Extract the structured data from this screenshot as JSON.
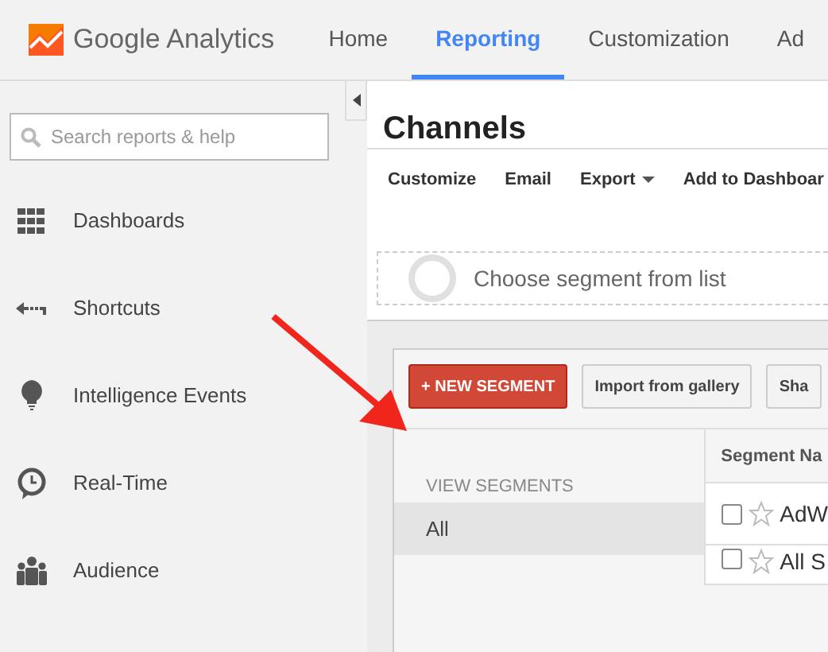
{
  "app": {
    "logo_text": "Google Analytics"
  },
  "nav_tabs": [
    {
      "label": "Home",
      "selected": false
    },
    {
      "label": "Reporting",
      "selected": true
    },
    {
      "label": "Customization",
      "selected": false
    },
    {
      "label": "Ad",
      "selected": false
    }
  ],
  "sidebar": {
    "search": {
      "placeholder": "Search reports & help"
    },
    "items": [
      {
        "label": "Dashboards",
        "kind": "grid"
      },
      {
        "label": "Shortcuts",
        "kind": "shortcut"
      },
      {
        "label": "Intelligence Events",
        "kind": "bulb"
      },
      {
        "label": "Real-Time",
        "kind": "clock"
      },
      {
        "label": "Audience",
        "kind": "people"
      }
    ]
  },
  "report": {
    "title": "Channels",
    "toolbar": [
      {
        "label": "Customize",
        "kind": "plain"
      },
      {
        "label": "Email",
        "kind": "plain"
      },
      {
        "label": "Export",
        "kind": "menu"
      },
      {
        "label": "Add to Dashboar",
        "kind": "plain"
      }
    ],
    "segment_picker": {
      "placeholder": "Choose segment from list"
    }
  },
  "segments_panel": {
    "buttons": [
      {
        "label": "+ NEW SEGMENT",
        "kind": "primary"
      },
      {
        "label": "Import from gallery",
        "kind": "secondary"
      },
      {
        "label": "Sha",
        "kind": "secondary"
      }
    ],
    "view_heading": "VIEW SEGMENTS",
    "views": [
      {
        "label": "All",
        "selected": true
      }
    ],
    "column_header": "Segment Na",
    "rows": [
      {
        "name": "AdW",
        "checked": false,
        "starred": false
      },
      {
        "name": "All S",
        "checked": false,
        "starred": false
      }
    ]
  }
}
